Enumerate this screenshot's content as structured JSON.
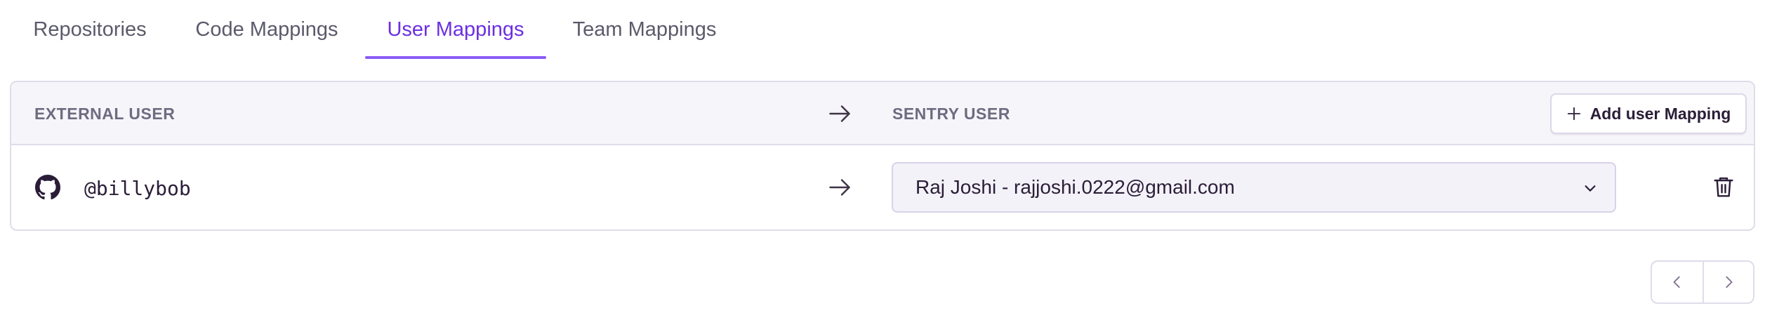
{
  "tabs": [
    {
      "label": "Repositories"
    },
    {
      "label": "Code Mappings"
    },
    {
      "label": "User Mappings",
      "active": true
    },
    {
      "label": "Team Mappings"
    }
  ],
  "table": {
    "headers": {
      "external_user": "EXTERNAL USER",
      "sentry_user": "SENTRY USER"
    },
    "add_button_label": "Add user Mapping",
    "rows": [
      {
        "provider_icon": "github-icon",
        "external_user": "@billybob",
        "sentry_user_selected": "Raj Joshi - rajjoshi.0222@gmail.com"
      }
    ]
  },
  "icons": {
    "arrow": "arrow-right-icon",
    "add": "plus-icon",
    "dropdown": "chevron-down-icon",
    "delete": "trash-icon",
    "prev": "chevron-left-icon",
    "next": "chevron-right-icon"
  },
  "colors": {
    "accent": "#6c2fe1",
    "tab_underline": "#8b5cf6",
    "header_bg": "#f6f5fa",
    "border": "#e0dcea",
    "text": "#2b1d38",
    "muted": "#6f6b80"
  }
}
